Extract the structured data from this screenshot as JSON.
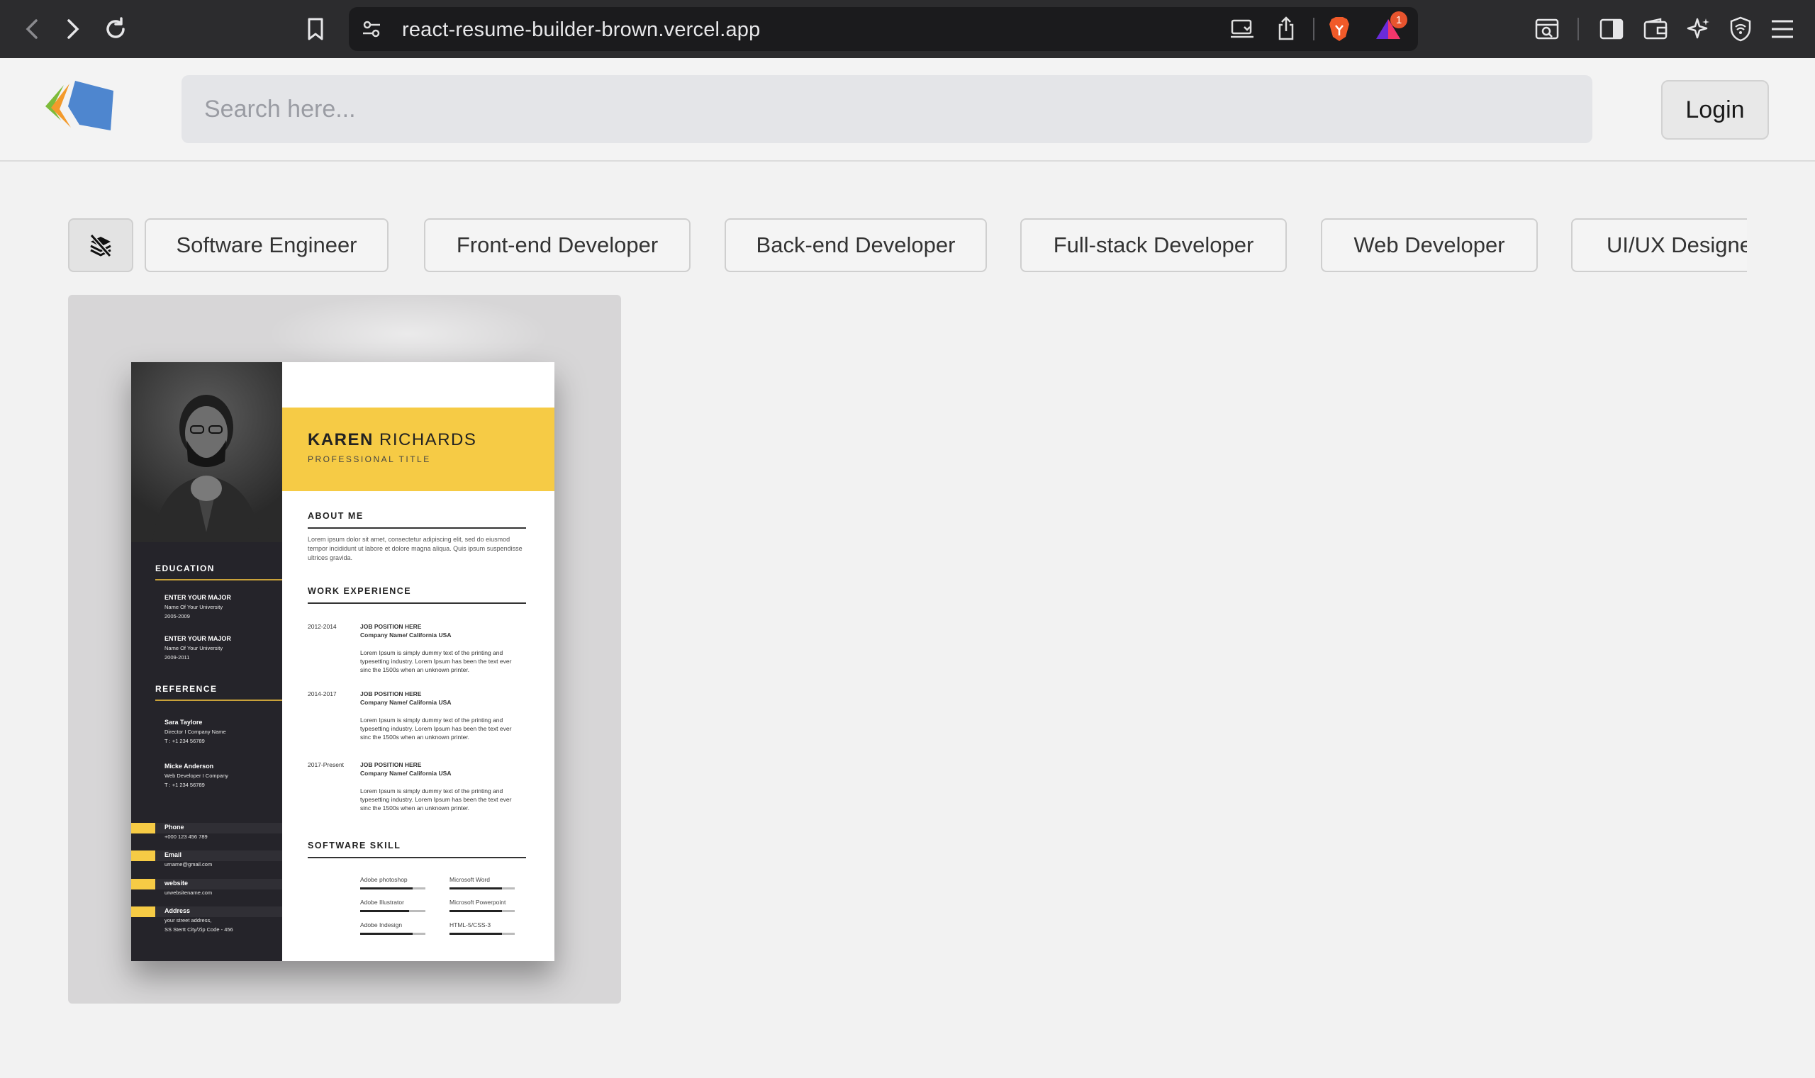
{
  "browser": {
    "url": "react-resume-builder-brown.vercel.app",
    "notification_count": "1"
  },
  "header": {
    "search_placeholder": "Search here...",
    "login_label": "Login"
  },
  "filters": {
    "items": [
      {
        "label": "Software Engineer"
      },
      {
        "label": "Front-end Developer"
      },
      {
        "label": "Back-end Developer"
      },
      {
        "label": "Full-stack Developer"
      },
      {
        "label": "Web Developer"
      },
      {
        "label": "UI/UX Designer"
      }
    ]
  },
  "template": {
    "first_name": "KAREN",
    "last_name": "RICHARDS",
    "professional_title": "PROFESSIONAL TITLE",
    "about_heading": "ABOUT ME",
    "about_text": "Lorem ipsum dolor sit amet, consectetur adipiscing elit, sed do eiusmod tempor incididunt ut labore et dolore magna aliqua. Quis ipsum suspendisse ultrices gravida.",
    "work_heading": "WORK EXPERIENCE",
    "jobs": [
      {
        "years": "2012-2014",
        "position": "JOB POSITION HERE",
        "company": "Company Name/ California USA",
        "desc": "Lorem Ipsum is simply dummy text of the printing and typesetting industry. Lorem Ipsum has been the text ever sinc the 1500s when an unknown printer."
      },
      {
        "years": "2014-2017",
        "position": "JOB POSITION HERE",
        "company": "Company Name/ California USA",
        "desc": "Lorem Ipsum is simply dummy text of the printing and typesetting industry. Lorem Ipsum has been the text ever sinc the 1500s when an unknown printer."
      },
      {
        "years": "2017-Present",
        "position": "JOB POSITION HERE",
        "company": "Company Name/ California USA",
        "desc": "Lorem Ipsum is simply dummy text of the printing and typesetting industry. Lorem Ipsum has been the text ever sinc the 1500s when an unknown printer."
      }
    ],
    "skill_heading": "SOFTWARE SKILL",
    "skills": [
      {
        "name": "Adobe photoshop",
        "level": 0.8
      },
      {
        "name": "Microsoft Word",
        "level": 0.8
      },
      {
        "name": "Adobe Illustrator",
        "level": 0.75
      },
      {
        "name": "Microsoft Powerpoint",
        "level": 0.8
      },
      {
        "name": "Adobe Indesign",
        "level": 0.8
      },
      {
        "name": "HTML-5/CSS-3",
        "level": 0.8
      }
    ],
    "education_heading": "EDUCATION",
    "education": [
      {
        "major": "ENTER YOUR MAJOR",
        "school": "Name Of Your University",
        "years": "2005-2009"
      },
      {
        "major": "ENTER YOUR MAJOR",
        "school": "Name Of Your University",
        "years": "2009-2011"
      }
    ],
    "reference_heading": "REFERENCE",
    "references": [
      {
        "name": "Sara Taylore",
        "role": "Director I Company Name",
        "phone": "T : +1 234 56789"
      },
      {
        "name": "Micke Anderson",
        "role": "Web Developer I Company",
        "phone": "T : +1 234 56789"
      }
    ],
    "contacts": [
      {
        "label": "Phone",
        "value": "+000 123 456 789"
      },
      {
        "label": "Email",
        "value": "urname@gmail.com"
      },
      {
        "label": "website",
        "value": "urwebsitename.com"
      },
      {
        "label": "Address",
        "value": "your street address,",
        "value2": "SS Stertt City/Zip Code - 456"
      }
    ],
    "accent_color": "#f6cb45",
    "sidebar_color": "#25242a"
  }
}
